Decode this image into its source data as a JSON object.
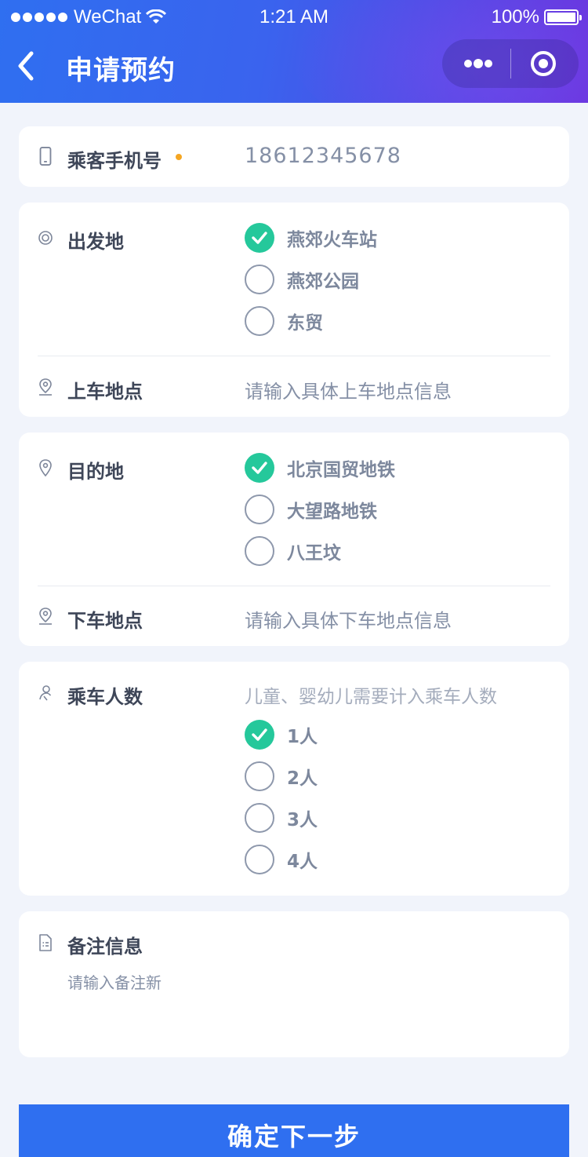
{
  "status_bar": {
    "carrier": "WeChat",
    "time": "1:21 AM",
    "battery": "100%",
    "battery_level": 1.0
  },
  "nav": {
    "title": "申请预约",
    "back_icon": "chevron-left-icon",
    "more_icon": "more-dots-icon",
    "close_icon": "target-circle-icon"
  },
  "phone": {
    "label": "乘客手机号",
    "value": "18612345678",
    "required_color": "#f5a623"
  },
  "departure": {
    "label": "出发地",
    "options": [
      {
        "label": "燕郊火车站",
        "selected": true
      },
      {
        "label": "燕郊公园",
        "selected": false
      },
      {
        "label": "东贸",
        "selected": false
      }
    ],
    "pickup_label": "上车地点",
    "pickup_placeholder": "请输入具体上车地点信息"
  },
  "destination": {
    "label": "目的地",
    "options": [
      {
        "label": "北京国贸地铁",
        "selected": true
      },
      {
        "label": "大望路地铁",
        "selected": false
      },
      {
        "label": "八王坟",
        "selected": false
      }
    ],
    "dropoff_label": "下车地点",
    "dropoff_placeholder": "请输入具体下车地点信息"
  },
  "passengers": {
    "label": "乘车人数",
    "hint": "儿童、婴幼儿需要计入乘车人数",
    "options": [
      {
        "label": "1人",
        "selected": true
      },
      {
        "label": "2人",
        "selected": false
      },
      {
        "label": "3人",
        "selected": false
      },
      {
        "label": "4人",
        "selected": false
      }
    ]
  },
  "remarks": {
    "label": "备注信息",
    "placeholder": "请输入备注新"
  },
  "submit_label": "确定下一步",
  "colors": {
    "primary": "#2f6ff0",
    "selected": "#25c89b",
    "background": "#f1f4fb"
  }
}
